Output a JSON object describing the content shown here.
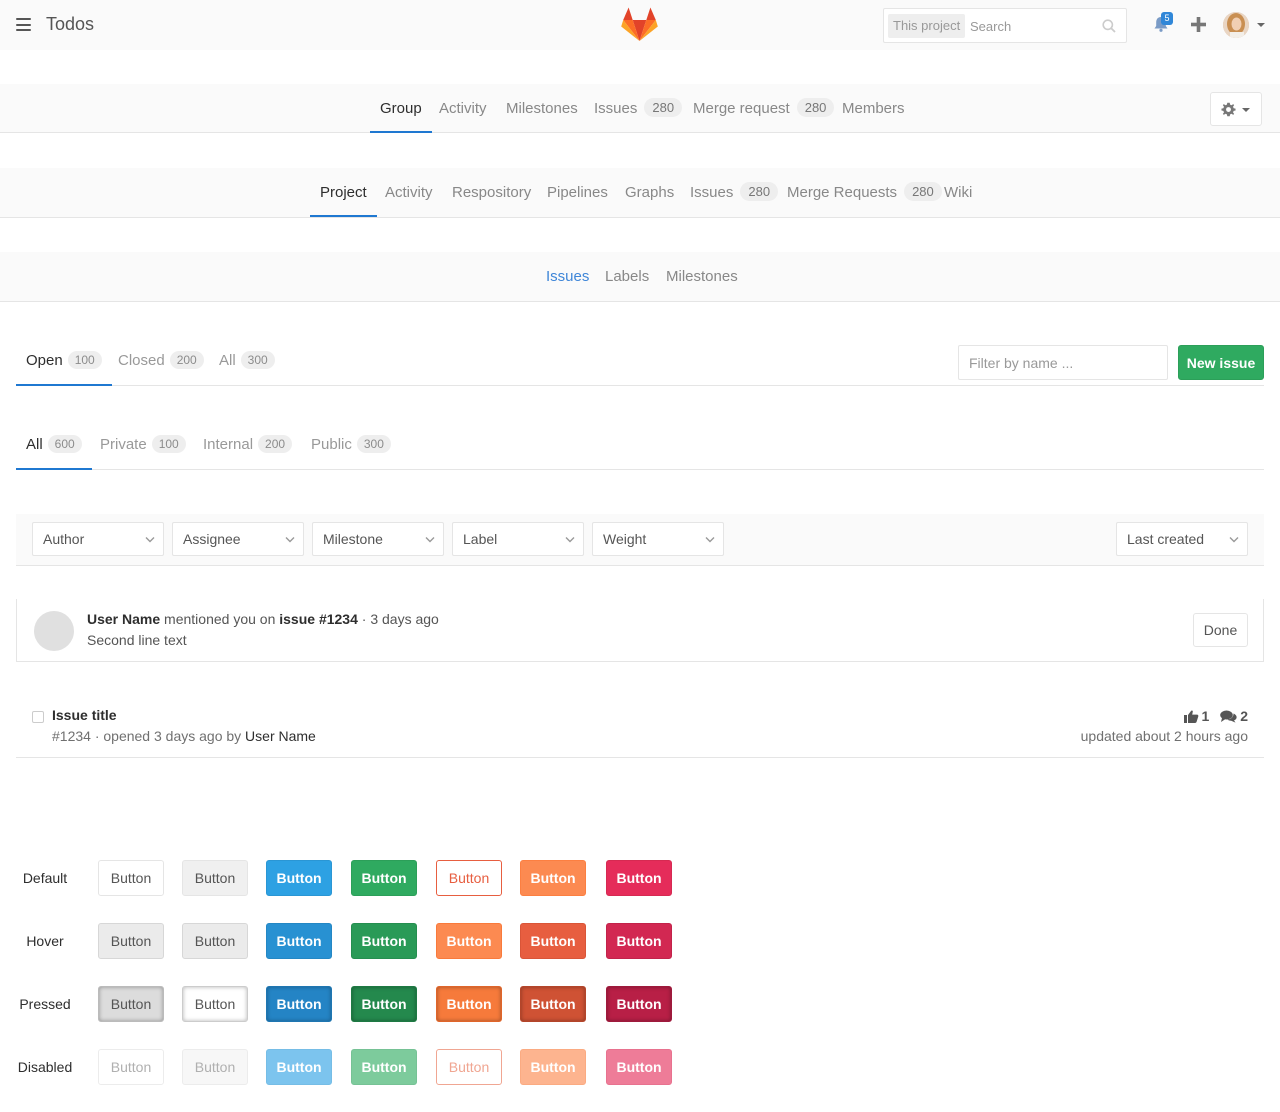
{
  "header": {
    "title": "Todos",
    "search_scope": "This project",
    "search_placeholder": "Search",
    "notification_count": "5"
  },
  "group_nav": {
    "items": [
      {
        "label": "Group"
      },
      {
        "label": "Activity"
      },
      {
        "label": "Milestones"
      },
      {
        "label": "Issues",
        "count": "280"
      },
      {
        "label": "Merge request",
        "count": "280"
      },
      {
        "label": "Members"
      }
    ],
    "active": "Group"
  },
  "project_nav": {
    "items": [
      {
        "label": "Project"
      },
      {
        "label": "Activity"
      },
      {
        "label": "Respository"
      },
      {
        "label": "Pipelines"
      },
      {
        "label": "Graphs"
      },
      {
        "label": "Issues",
        "count": "280"
      },
      {
        "label": "Merge Requests",
        "count": "280"
      },
      {
        "label": "Wiki"
      }
    ],
    "active": "Project"
  },
  "sub_nav": {
    "items": [
      {
        "label": "Issues"
      },
      {
        "label": "Labels"
      },
      {
        "label": "Milestones"
      }
    ],
    "active": "Issues"
  },
  "state_tabs": {
    "items": [
      {
        "label": "Open",
        "count": "100"
      },
      {
        "label": "Closed",
        "count": "200"
      },
      {
        "label": "All",
        "count": "300"
      }
    ],
    "filter_placeholder": "Filter by name ...",
    "new_issue_label": "New issue"
  },
  "visibility_tabs": {
    "items": [
      {
        "label": "All",
        "count": "600"
      },
      {
        "label": "Private",
        "count": "100"
      },
      {
        "label": "Internal",
        "count": "200"
      },
      {
        "label": "Public",
        "count": "300"
      }
    ]
  },
  "filters": {
    "author": "Author",
    "assignee": "Assignee",
    "milestone": "Milestone",
    "label": "Label",
    "weight": "Weight",
    "sort": "Last created"
  },
  "todo": {
    "user": "User Name",
    "action": " mentioned you on ",
    "target": "issue #1234",
    "time": " · 3 days ago",
    "second_line": "Second line text",
    "done_label": "Done"
  },
  "issue": {
    "title": "Issue title",
    "meta_prefix": "#1234 · opened 3 days ago by ",
    "author": "User Name",
    "upvotes": "1",
    "comments": "2",
    "updated": "updated about 2 hours ago"
  },
  "button_states": {
    "rows": [
      "Default",
      "Hover",
      "Pressed",
      "Disabled"
    ],
    "button_label": "Button"
  },
  "colors": {
    "accent_blue": "#1f78d1",
    "green": "#2faa60",
    "orange": "#fc8a51",
    "red_orange": "#e75e40",
    "pink": "#e52c5a",
    "info_blue": "#2da1e3"
  }
}
